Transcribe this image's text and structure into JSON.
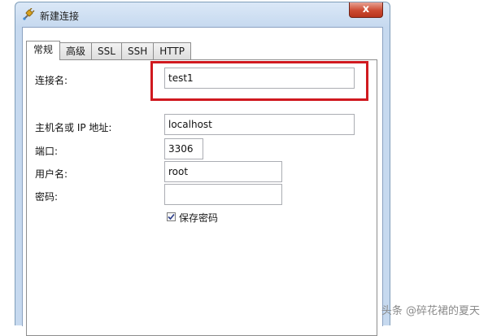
{
  "window": {
    "title": "新建连接",
    "close_glyph": "x"
  },
  "tabs": [
    {
      "label": "常规",
      "active": true
    },
    {
      "label": "高级",
      "active": false
    },
    {
      "label": "SSL",
      "active": false
    },
    {
      "label": "SSH",
      "active": false
    },
    {
      "label": "HTTP",
      "active": false
    }
  ],
  "form": {
    "connection_name": {
      "label": "连接名:",
      "value": "test1"
    },
    "host": {
      "label": "主机名或 IP 地址:",
      "value": "localhost"
    },
    "port": {
      "label": "端口:",
      "value": "3306"
    },
    "username": {
      "label": "用户名:",
      "value": "root"
    },
    "password": {
      "label": "密码:",
      "value": ""
    },
    "save_password": {
      "label": "保存密码",
      "checked": true
    }
  },
  "watermark": {
    "text": "头条 @碎花裙的夏天"
  },
  "colors": {
    "highlight": "#d0191f",
    "close_button": "#cc4a31"
  },
  "icons": {
    "title": "connection-plug-icon",
    "checkbox": "checkmark-icon"
  }
}
